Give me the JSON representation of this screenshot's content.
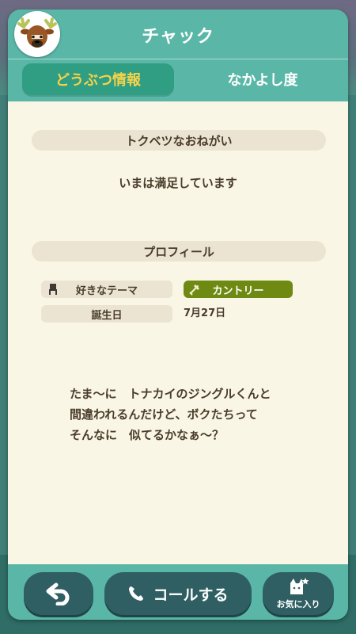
{
  "header": {
    "title": "チャック"
  },
  "tabs": [
    {
      "label": "どうぶつ情報",
      "active": true
    },
    {
      "label": "なかよし度",
      "active": false
    }
  ],
  "wish": {
    "header": "トクベツなおねがい",
    "text": "いまは満足しています"
  },
  "profile": {
    "header": "プロフィール",
    "rows": [
      {
        "label": "好きなテーマ",
        "value": "カントリー",
        "icon": "chair-icon",
        "value_icon": "broom-icon"
      },
      {
        "label": "誕生日",
        "value": "7月27日"
      }
    ]
  },
  "quote": "たま〜に　トナカイのジングルくんと\n間違われるんだけど、ボクたちって\nそんなに　似てるかなぁ〜？",
  "bottom": {
    "back_icon": "back-arrow-icon",
    "call_label": "コールする",
    "call_icon": "phone-icon",
    "favorite_label": "お気に入り",
    "favorite_icon": "cat-star-icon"
  },
  "colors": {
    "primary": "#5ab7a7",
    "tab_active_bg": "#2f9e83",
    "tab_active_text": "#f5d24a",
    "content_bg": "#f9f6e6",
    "section_bg": "#ebe4d2",
    "text": "#4a3c2a",
    "theme_badge": "#6f8a12",
    "button_bg": "#2f5f63"
  }
}
